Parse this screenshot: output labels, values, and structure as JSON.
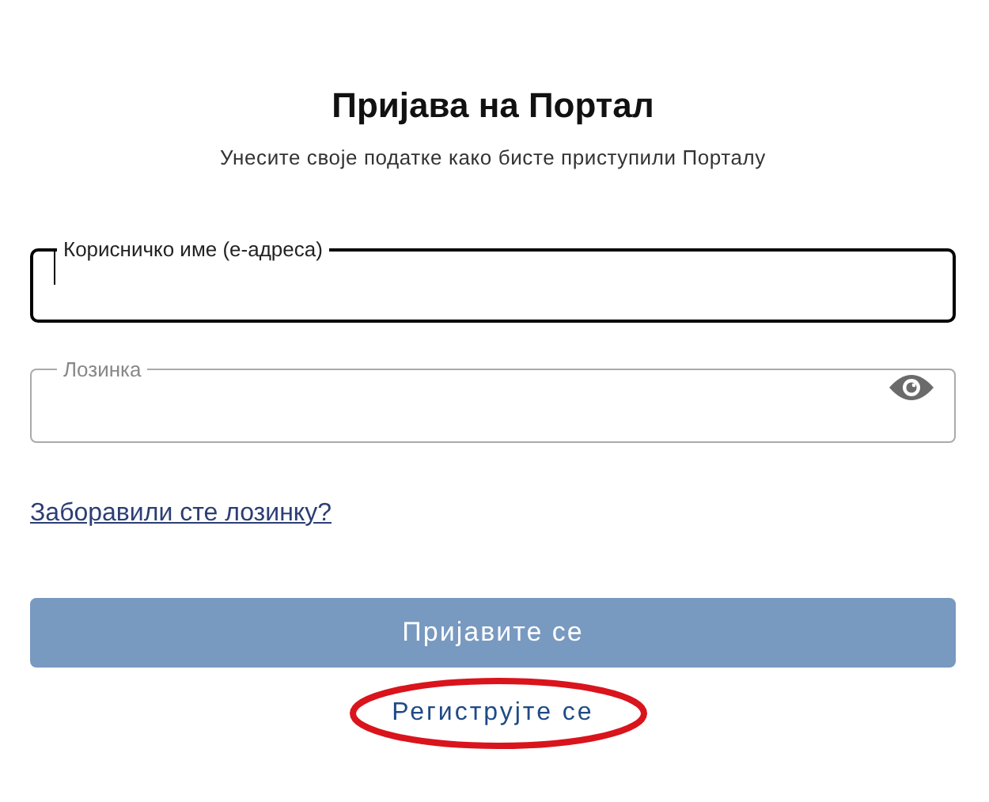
{
  "title": "Пријава на Портал",
  "subtitle": "Унесите своје податке како бисте приступили Порталу",
  "fields": [
    {
      "label": "Корисничко име (е-адреса)",
      "focused": true,
      "kind": "text"
    },
    {
      "label": "Лозинка",
      "focused": false,
      "kind": "password"
    }
  ],
  "forgot_link": "Заборавили сте лозинку?",
  "submit": {
    "label": "Пријавите се",
    "disabled": true
  },
  "register_link": {
    "label": "Региструјте се",
    "circled": true
  }
}
